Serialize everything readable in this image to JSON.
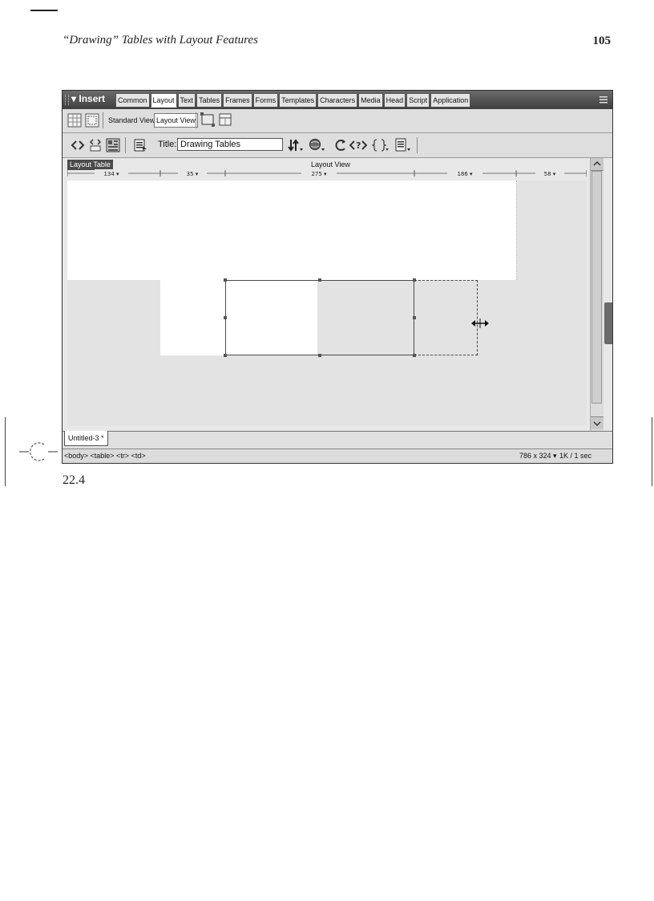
{
  "page": {
    "running_head": "“Drawing” Tables with Layout Features",
    "page_number": "105",
    "figure_number": "22.4"
  },
  "insert_bar": {
    "label": "▾ Insert",
    "tabs": [
      {
        "label": "Common",
        "active": false
      },
      {
        "label": "Layout",
        "active": true
      },
      {
        "label": "Text",
        "active": false
      },
      {
        "label": "Tables",
        "active": false
      },
      {
        "label": "Frames",
        "active": false
      },
      {
        "label": "Forms",
        "active": false
      },
      {
        "label": "Templates",
        "active": false
      },
      {
        "label": "Characters",
        "active": false
      },
      {
        "label": "Media",
        "active": false
      },
      {
        "label": "Head",
        "active": false
      },
      {
        "label": "Script",
        "active": false
      },
      {
        "label": "Application",
        "active": false
      }
    ]
  },
  "layout_toolbar": {
    "standard_view": "Standard View",
    "layout_view": "Layout View"
  },
  "doc_toolbar": {
    "title_label": "Title:",
    "title_value": "Drawing Tables"
  },
  "document": {
    "layout_table_tag": "Layout Table",
    "layout_view_label": "Layout View",
    "column_widths": [
      "134 ▾",
      "35 ▾",
      "275 ▾",
      "186 ▾",
      "58 ▾"
    ],
    "tab_name": "Untitled-3 *"
  },
  "status_bar": {
    "tag_selector": "<body> <table> <tr> <td>",
    "window_size": "786 x 324 ▾",
    "download_stat": "1K / 1 sec"
  },
  "colors": {
    "insert_bar": "#4f4f4f",
    "toolbar_bg": "#dedede",
    "canvas_bg": "#e3e3e3"
  }
}
